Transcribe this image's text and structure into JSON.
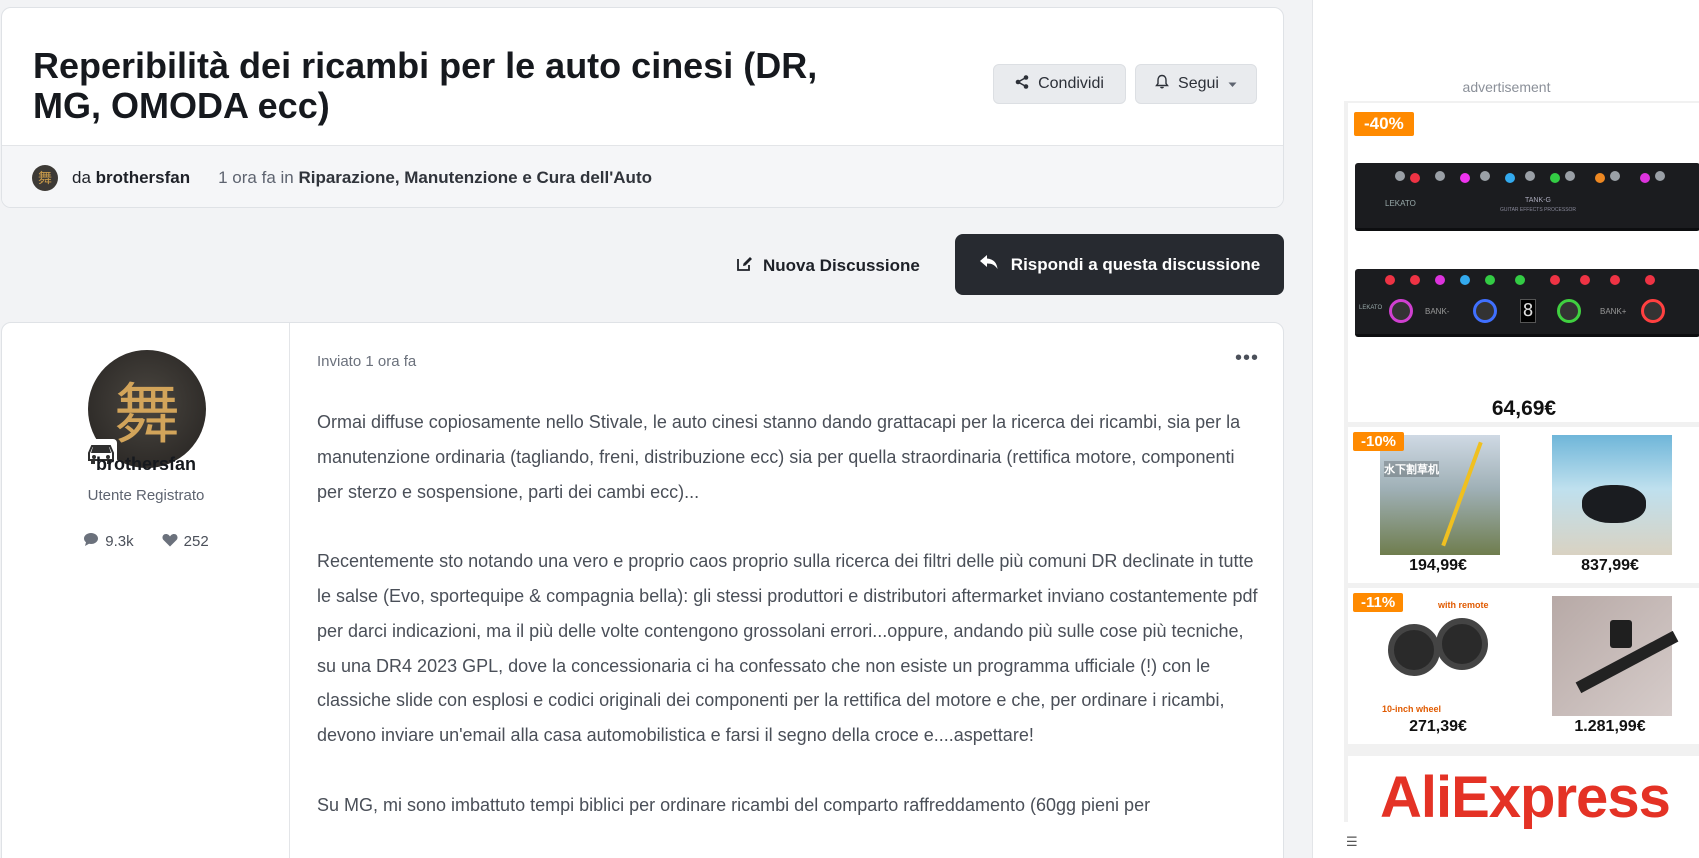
{
  "topic": {
    "title": "Reperibilità dei ricambi per le auto cinesi (DR, MG, OMODA ecc)",
    "share_label": "Condividi",
    "follow_label": "Segui",
    "by_prefix": "da",
    "author": "brothersfan",
    "time_prefix": "1 ora fa in",
    "category": "Riparazione, Manutenzione e Cura dell'Auto"
  },
  "actions": {
    "new_topic_label": "Nuova Discussione",
    "reply_label": "Rispondi a questa discussione"
  },
  "post": {
    "author_name": "brothersfan",
    "author_role": "Utente Registrato",
    "posts_count": "9.3k",
    "reputation": "252",
    "posted_label": "Inviato 1 ora fa",
    "more_label": "•••",
    "paragraphs": [
      "Ormai diffuse copiosamente nello Stivale, le auto cinesi stanno dando grattacapi per la ricerca dei ricambi, sia per la manutenzione ordinaria (tagliando, freni, distribuzione ecc) sia per quella straordinaria (rettifica motore, componenti per sterzo e sospensione, parti dei cambi ecc)...",
      "Recentemente sto notando una vero e proprio caos proprio sulla ricerca dei filtri delle più comuni DR declinate in tutte le salse (Evo, sportequipe & compagnia bella): gli stessi produttori e distributori aftermarket inviano costantemente pdf per darci indicazioni, ma il più delle volte contengono grossolani errori...oppure, andando più sulle cose più tecniche, su una DR4 2023 GPL, dove la concessionaria ci ha confessato che non esiste un programma ufficiale (!) con le classiche slide con esplosi e codici originali dei componenti per la rettifica del motore e che, per ordinare i ricambi, devono inviare un'email alla casa automobilistica e farsi il segno della croce e....aspettare!",
      "Su MG, mi sono imbattuto tempi biblici per ordinare ricambi del comparto raffreddamento (60gg pieni per"
    ]
  },
  "ad": {
    "label": "advertisement",
    "main_badge": "-40%",
    "main_price": "64,69€",
    "tiles": [
      {
        "badge": "-10%",
        "price": "194,99€"
      },
      {
        "badge": "",
        "price": "837,99€"
      },
      {
        "badge": "-11%",
        "price": "271,39€"
      },
      {
        "badge": "",
        "price": "1.281,99€"
      }
    ],
    "brand": "AliExpress",
    "tile1_text": "水下割草机",
    "tile3_caption_top": "with remote",
    "tile3_caption_bottom": "10-inch wheel",
    "pedal_brand": "LEKATO",
    "pedal_model": "TANK-G",
    "pedal_sub": "GUITAR EFFECTS PROCESSOR",
    "pedal_bank_left": "BANK-",
    "pedal_bank_right": "BANK+",
    "pedal_display": "8"
  },
  "colors": {
    "reply_button": "#272a30",
    "badge": "#ff8a00",
    "brand_red": "#e43225"
  }
}
